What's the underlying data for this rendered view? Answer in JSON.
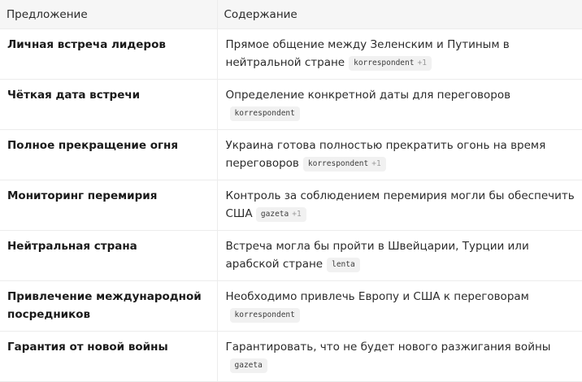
{
  "table": {
    "headers": {
      "proposal": "Предложение",
      "content": "Содержание"
    },
    "rows": [
      {
        "proposal": "Личная встреча лидеров",
        "content": "Прямое общение между Зеленским и Путиным в нейтральной стране",
        "source": "korrespondent",
        "extra": "+1"
      },
      {
        "proposal": "Чёткая дата встречи",
        "content": "Определение конкретной даты для переговоров",
        "source": "korrespondent",
        "extra": ""
      },
      {
        "proposal": "Полное прекращение огня",
        "content": "Украина готова полностью прекратить огонь на время переговоров",
        "source": "korrespondent",
        "extra": "+1"
      },
      {
        "proposal": "Мониторинг перемирия",
        "content": "Контроль за соблюдением перемирия могли бы обеспечить США",
        "source": "gazeta",
        "extra": "+1"
      },
      {
        "proposal": "Нейтральная страна",
        "content": "Встреча могла бы пройти в Швейцарии, Турции или арабской стране",
        "source": "lenta",
        "extra": ""
      },
      {
        "proposal": "Привлечение международной посредников",
        "content": "Необходимо привлечь Европу и США к переговорам",
        "source": "korrespondent",
        "extra": ""
      },
      {
        "proposal": "Гарантия от новой войны",
        "content": "Гарантировать, что не будет нового разжигания войны",
        "source": "gazeta",
        "extra": ""
      }
    ]
  }
}
